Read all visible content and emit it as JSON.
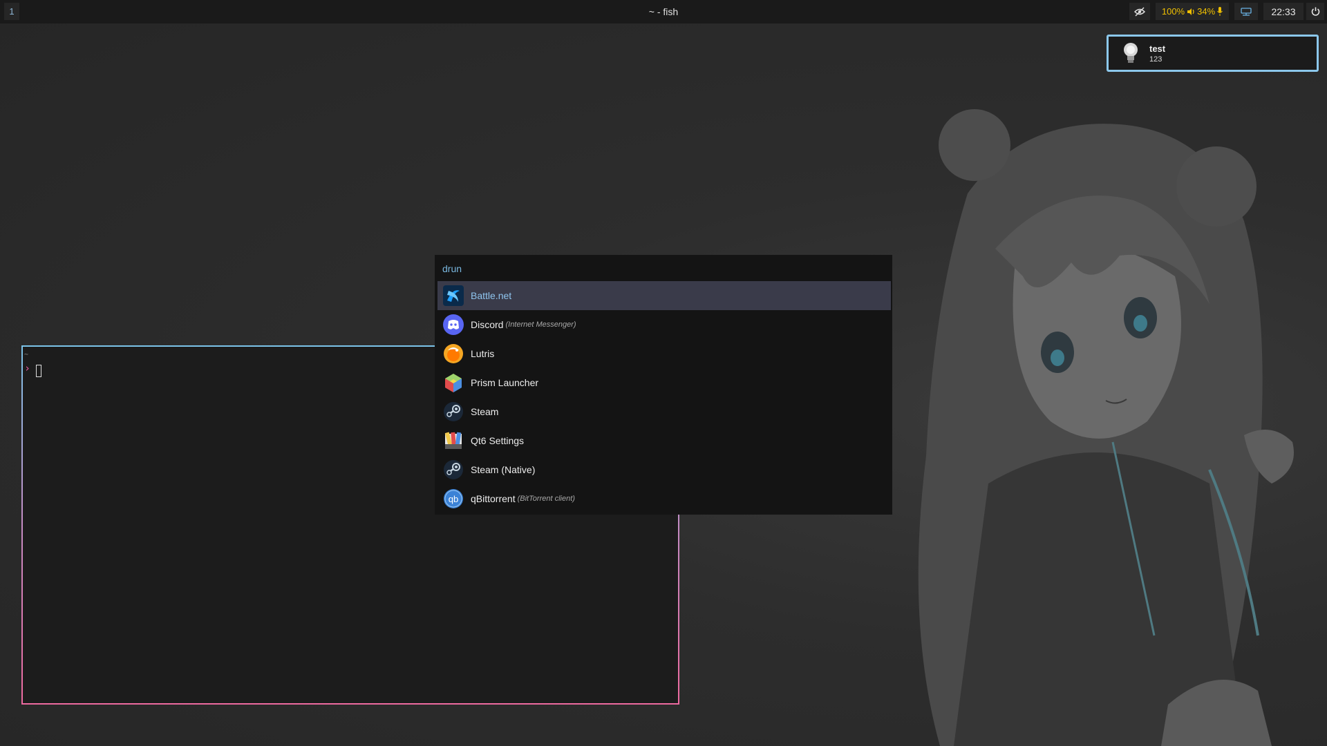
{
  "topbar": {
    "workspace": "1",
    "window_title": "~ - fish",
    "eye_icon": "eye-slash-icon",
    "volume_percent": "100%",
    "volume_icon": "speaker-icon",
    "mic_percent": "34%",
    "mic_icon": "microphone-icon",
    "network_icon": "network-icon",
    "clock": "22:33",
    "power_icon": "power-icon"
  },
  "notification": {
    "icon": "lightbulb-icon",
    "summary": "test",
    "body": "123"
  },
  "terminal": {
    "cwd": "~",
    "prompt": "›"
  },
  "launcher": {
    "mode": "drun",
    "items": [
      {
        "name": "Battle.net",
        "generic": "",
        "icon": "battlenet-icon",
        "selected": true
      },
      {
        "name": "Discord",
        "generic": "(Internet Messenger)",
        "icon": "discord-icon"
      },
      {
        "name": "Lutris",
        "generic": "",
        "icon": "lutris-icon"
      },
      {
        "name": "Prism Launcher",
        "generic": "",
        "icon": "prism-launcher-icon"
      },
      {
        "name": "Steam",
        "generic": "",
        "icon": "steam-icon"
      },
      {
        "name": "Qt6 Settings",
        "generic": "",
        "icon": "qt6-settings-icon"
      },
      {
        "name": "Steam (Native)",
        "generic": "",
        "icon": "steam-native-icon"
      },
      {
        "name": "qBittorrent",
        "generic": "(BitTorrent client)",
        "icon": "qbittorrent-icon"
      }
    ]
  },
  "colors": {
    "accent": "#8cc8ec",
    "terminal_border_bottom": "#ee6aa0",
    "selected_row": "#3a3b4a",
    "audio_text": "#f0c000"
  }
}
